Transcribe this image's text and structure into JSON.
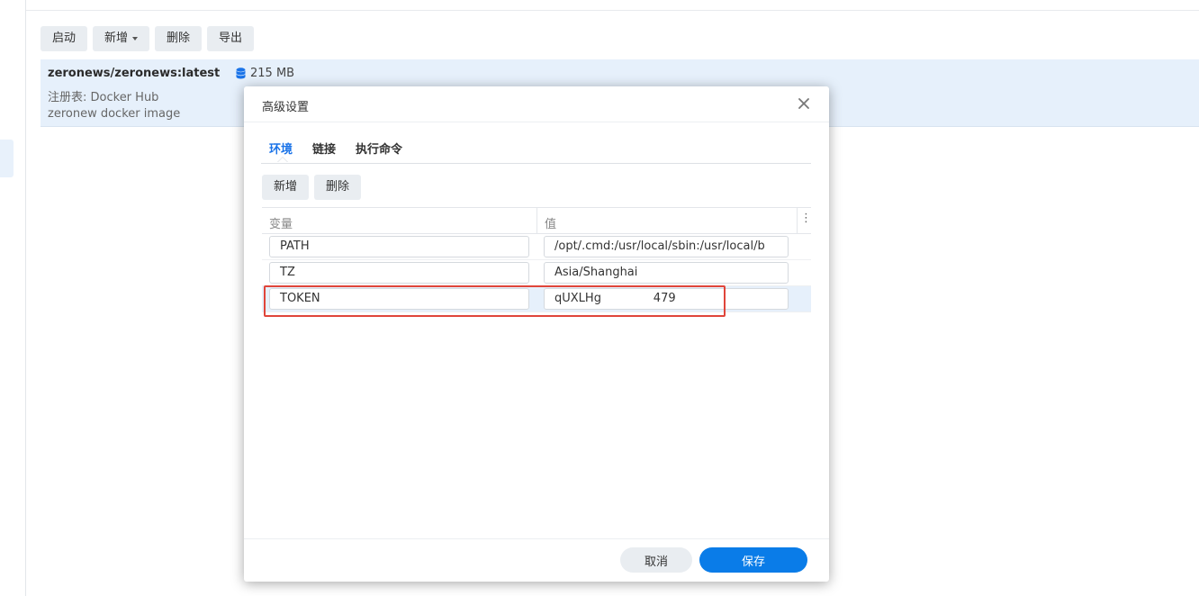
{
  "toolbar": {
    "start_label": "启动",
    "add_label": "新增",
    "delete_label": "删除",
    "export_label": "导出"
  },
  "image": {
    "name": "zeronews/zeronews:latest",
    "size": "215 MB",
    "registry": "注册表: Docker Hub",
    "description": "zeronew docker image"
  },
  "dialog": {
    "title": "高级设置",
    "tabs": [
      {
        "label": "环境"
      },
      {
        "label": "链接"
      },
      {
        "label": "执行命令"
      }
    ],
    "add_label": "新增",
    "delete_label": "删除",
    "columns": {
      "variable": "变量",
      "value": "值",
      "more": "⋮"
    },
    "rows": [
      {
        "key": "PATH",
        "value": "/opt/.cmd:/usr/local/sbin:/usr/local/b"
      },
      {
        "key": "TZ",
        "value": "Asia/Shanghai"
      },
      {
        "key": "TOKEN",
        "value": "qUXLHg              479"
      }
    ],
    "cancel_label": "取消",
    "save_label": "保存"
  },
  "colors": {
    "accent": "#0a7ce8",
    "highlight": "#e0453a",
    "selected_row": "#e6f0fb"
  }
}
